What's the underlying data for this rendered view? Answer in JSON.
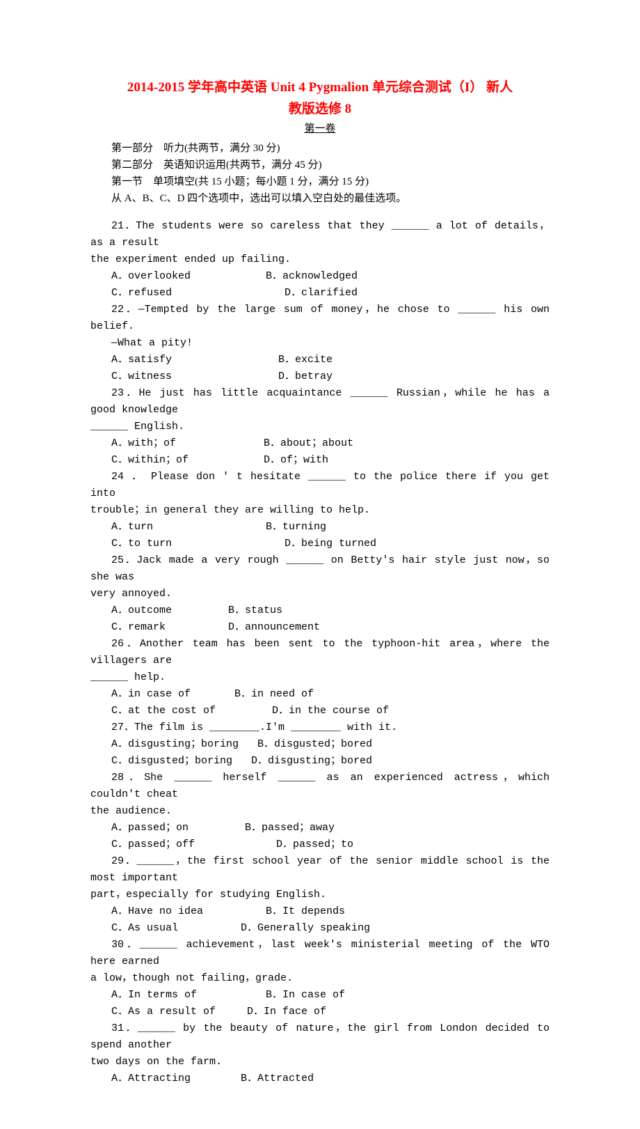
{
  "title_line1": "2014-2015 学年高中英语 Unit 4 Pygmalion 单元综合测试（I） 新人",
  "title_line2": "教版选修 8",
  "subtitle": "第一卷",
  "intro": {
    "l1": "第一部分　听力(共两节，满分 30 分)",
    "l2": "第二部分　英语知识运用(共两节，满分 45 分)",
    "l3": "第一节　单项填空(共 15 小题；每小题 1 分，满分 15 分)",
    "l4": "从 A、B、C、D 四个选项中，选出可以填入空白处的最佳选项。"
  },
  "q21": {
    "stem1": "21．The students were so careless that they ______ a lot of details，as a result",
    "stem2": "the experiment ended up failing.",
    "opt1": "A．overlooked            B．acknowledged",
    "opt2": "C．refused                  D．clarified"
  },
  "q22": {
    "stem1": "22．—Tempted by the large sum of money，he chose to ______ his own belief.",
    "stem2": "—What a pity!",
    "opt1": "A．satisfy                 B．excite",
    "opt2": "C．witness                 D．betray"
  },
  "q23": {
    "stem1": "23．He just has little acquaintance ______ Russian，while he has a good knowledge",
    "stem2": "______ English.",
    "opt1": "A．with；of              B．about；about",
    "opt2": "C．within；of            D．of；with"
  },
  "q24": {
    "stem1": "24 ． Please  don ' t  hesitate  ______  to  the  police  there  if  you  get  into",
    "stem2": "trouble；in general they are willing to help.",
    "opt1": "A．turn                  B．turning",
    "opt2": "C．to turn                  D．being turned"
  },
  "q25": {
    "stem1": "25．Jack made a very rough ______ on Betty's hair style just now，so she was",
    "stem2": "very annoyed.",
    "opt1": "A．outcome         B．status",
    "opt2": "C．remark          D．announcement"
  },
  "q26": {
    "stem1": "26．Another team has been sent to the typhoon-hit area，where the villagers are",
    "stem2": "______ help.",
    "opt1": "A．in case of       B．in need of",
    "opt2": "C．at the cost of         D．in the course of"
  },
  "q27": {
    "stem": "27．The film is ________.I'm ________ with it.",
    "opt1": "A．disgusting；boring   B．disgusted；bored",
    "opt2": "C．disgusted；boring   D．disgusting；bored"
  },
  "q28": {
    "stem1": "28．She ______ herself ______ as an experienced actress，which couldn't cheat",
    "stem2": "the audience.",
    "opt1": "A．passed；on         B．passed；away",
    "opt2": "C．passed；off             D．passed；to"
  },
  "q29": {
    "stem1": "29．______，the first school year of the senior middle school is the most important",
    "stem2": "part，especially for studying English.",
    "opt1": "A．Have no idea          B．It depends",
    "opt2": "C．As usual          D．Generally speaking"
  },
  "q30": {
    "stem1": "30．______ achievement，last week's ministerial meeting of the WTO here earned",
    "stem2": "a low，though not failing，grade.",
    "opt1": "A．In terms of           B．In case of",
    "opt2": "C．As a result of     D．In face of"
  },
  "q31": {
    "stem1": "31．______ by the beauty of nature，the girl from London decided to spend another",
    "stem2": "two days on the farm.",
    "opt1": "A．Attracting        B．Attracted"
  }
}
